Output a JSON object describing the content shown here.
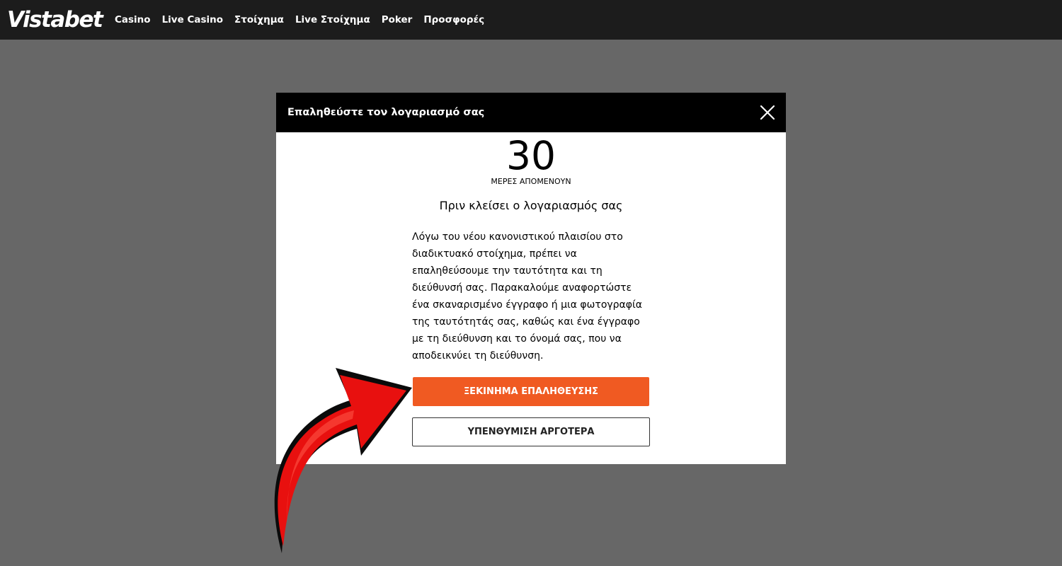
{
  "header": {
    "logo_text": "Vistabet",
    "nav": [
      {
        "label": "Casino"
      },
      {
        "label": "Live Casino"
      },
      {
        "label": "Στοίχημα"
      },
      {
        "label": "Live Στοίχημα"
      },
      {
        "label": "Poker"
      },
      {
        "label": "Προσφορές"
      }
    ]
  },
  "modal": {
    "title": "Επαληθεύστε τον λογαριασμό σας",
    "close_icon": "close-icon",
    "days_remaining": "30",
    "days_label": "ΜΕΡΕΣ ΑΠΟΜΕΝΟΥΝ",
    "subtitle": "Πριν κλείσει ο λογαριασμός σας",
    "body": "Λόγω του νέου κανονιστικού πλαισίου στο διαδικτυακό στοίχημα, πρέπει να επαληθεύσουμε την ταυτότητα και τη διεύθυνσή σας. Παρακαλούμε αναφορτώστε ένα σκαναρισμένο έγγραφο ή μια φωτογραφία της ταυτότητάς σας, καθώς και ένα έγγραφο με τη διεύθυνση και το όνομά σας, που να αποδεικνύει τη διεύθυνση.",
    "primary_button": "ΞΕΚΙΝΗΜΑ ΕΠΑΛΗΘΕΥΣΗΣ",
    "secondary_button": "ΥΠΕΝΘΥΜΙΣΗ ΑΡΓΟΤΕΡΑ"
  },
  "annotation": {
    "icon": "red-arrow-icon"
  },
  "colors": {
    "topbar": "#1c1c1c",
    "overlay": "#676767",
    "modal_header": "#000000",
    "primary_button": "#f05a22",
    "arrow": "#e8100f"
  }
}
